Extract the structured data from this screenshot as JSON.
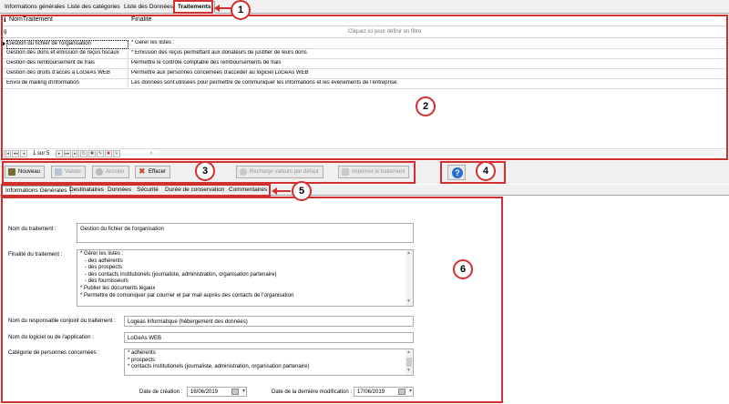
{
  "top_tabs": [
    "Informations générales",
    "Liste des catégories",
    "Liste des Données",
    "Traitements"
  ],
  "top_tab_active": "Traitements",
  "callouts": [
    "1",
    "2",
    "3",
    "4",
    "5",
    "6"
  ],
  "grid": {
    "col1_header": "NomTraitement",
    "col2_header": "Finalite",
    "header_icon": "ℹ",
    "filter_icon": "g",
    "filter_text": "Cliquez ici pour définir un filtre",
    "rows": [
      {
        "nom": "Gestion du fichier de l'organisation",
        "finalite": "* Gérer les listes :"
      },
      {
        "nom": "Gestion des dons et emission de reçus fiscaux",
        "finalite": "* Emission des reçus permettant aux donateurs de justifier de leurs dons"
      },
      {
        "nom": "Gestion des remboursement de frais",
        "finalite": "Permettre le contrôle comptable des remboursements de frais"
      },
      {
        "nom": "Gestion des droits d'accès à LoGeAs WEB",
        "finalite": "Permettre aux personnes concernées d'accéder au logiciel LoGeAs WEB"
      },
      {
        "nom": "Envoi de mailing d'information",
        "finalite": "Les données sont utilisées pour permettre de communiquer les informations et les évènements de l'entreprise."
      }
    ],
    "pager_text": "1 sur 5"
  },
  "toolbar": {
    "nouveau": "Nouveau",
    "valider": "Valider",
    "annuler": "Annuler",
    "effacer": "Effacer",
    "recharge": "Recharge valeurs par défaut",
    "imprimer": "Imprimer le traitement",
    "help": "?"
  },
  "sub_tabs": [
    "Informations Générales",
    "Destinataires",
    "Données",
    "Sécurité",
    "Durée de conservation",
    "Commentaires"
  ],
  "form": {
    "nom_label": "Nom du traitement :",
    "nom_value": "Gestion du fichier de l'organisation",
    "finalite_label": "Finalité du traitement :",
    "finalite_lines": [
      "* Gérer les listes :",
      "   - des adhérents",
      "   - des prospects",
      "   - des contacts institutionels (journaliste, administration, organisation partenaire)",
      "   - des fournisseurs",
      "* Publier les documents légaux",
      "* Permettre de comuniquer par courrier et par mail auprès des contacts de l'organisation"
    ],
    "responsable_label": "Nom du responsable conjoint du traitement :",
    "responsable_value": "Logeas Informatique (hébergement des données)",
    "logiciel_label": "Nom du logiciel ou de l'application :",
    "logiciel_value": "LoGeAs WEB",
    "categorie_label": "Catégorie de personnes concernées :",
    "categorie_lines": [
      "* adhérents",
      "* prospects",
      "* contacts institutionels (journaliste, administration, organisation partenaire)"
    ],
    "date_creation_label": "Date de création :",
    "date_creation_value": "16/06/2019",
    "date_modif_label": "Date de la dernière modification :",
    "date_modif_value": "17/06/2019"
  },
  "colors": {
    "annotation": "#d32f2f",
    "help_blue": "#2a6bd0"
  }
}
